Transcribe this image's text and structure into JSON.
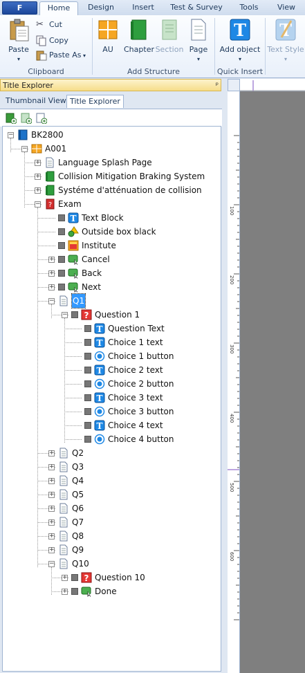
{
  "ribbon": {
    "file_tab": "F",
    "tabs": [
      "Home",
      "Design",
      "Insert",
      "Test & Survey",
      "Tools",
      "View"
    ],
    "clipboard": {
      "paste": "Paste",
      "cut": "Cut",
      "copy": "Copy",
      "paste_as": "Paste As",
      "group": "Clipboard"
    },
    "structure": {
      "au": "AU",
      "chapter": "Chapter",
      "section": "Section",
      "page": "Page",
      "group": "Add Structure"
    },
    "quick": {
      "add_object": "Add object",
      "group": "Quick Insert"
    },
    "text_style": "Text Style"
  },
  "panel": {
    "title": "Title Explorer",
    "pin": "ᵖ",
    "tabs": [
      "Thumbnail View",
      "Title Explorer"
    ]
  },
  "tree": [
    {
      "label": "BK2800",
      "icon": "book-icon"
    },
    {
      "label": "A001",
      "icon": "au-icon"
    },
    {
      "label": "Language Splash Page",
      "icon": "page-icon"
    },
    {
      "label": "Collision Mitigation Braking System",
      "icon": "chapter-icon"
    },
    {
      "label": "Systéme d'atténuation de collision",
      "icon": "chapter-icon"
    },
    {
      "label": "Exam",
      "icon": "exam-icon"
    },
    {
      "label": "Text Block",
      "icon": "text-icon"
    },
    {
      "label": "Outside box black",
      "icon": "shape-icon"
    },
    {
      "label": "Institute",
      "icon": "image-icon"
    },
    {
      "label": "Cancel",
      "icon": "button-icon"
    },
    {
      "label": "Back",
      "icon": "button-icon"
    },
    {
      "label": "Next",
      "icon": "button-icon"
    },
    {
      "label": "Q1",
      "icon": "page-icon"
    },
    {
      "label": "Question 1",
      "icon": "question-icon"
    },
    {
      "label": "Question Text",
      "icon": "text-icon"
    },
    {
      "label": "Choice 1 text",
      "icon": "text-icon"
    },
    {
      "label": "Choice 1 button",
      "icon": "radio-icon"
    },
    {
      "label": "Choice 2 text",
      "icon": "text-icon"
    },
    {
      "label": "Choice 2 button",
      "icon": "radio-icon"
    },
    {
      "label": "Choice 3 text",
      "icon": "text-icon"
    },
    {
      "label": "Choice 3 button",
      "icon": "radio-icon"
    },
    {
      "label": "Choice 4 text",
      "icon": "text-icon"
    },
    {
      "label": "Choice 4 button",
      "icon": "radio-icon"
    },
    {
      "label": "Q2",
      "icon": "page-icon"
    },
    {
      "label": "Q3",
      "icon": "page-icon"
    },
    {
      "label": "Q4",
      "icon": "page-icon"
    },
    {
      "label": "Q5",
      "icon": "page-icon"
    },
    {
      "label": "Q6",
      "icon": "page-icon"
    },
    {
      "label": "Q7",
      "icon": "page-icon"
    },
    {
      "label": "Q8",
      "icon": "page-icon"
    },
    {
      "label": "Q9",
      "icon": "page-icon"
    },
    {
      "label": "Q10",
      "icon": "page-icon"
    },
    {
      "label": "Question 10",
      "icon": "question-icon"
    },
    {
      "label": "Done",
      "icon": "button-icon"
    }
  ],
  "selected_item": "Q1",
  "ruler": {
    "labels": [
      "100",
      "200",
      "300",
      "400",
      "500",
      "600"
    ]
  }
}
